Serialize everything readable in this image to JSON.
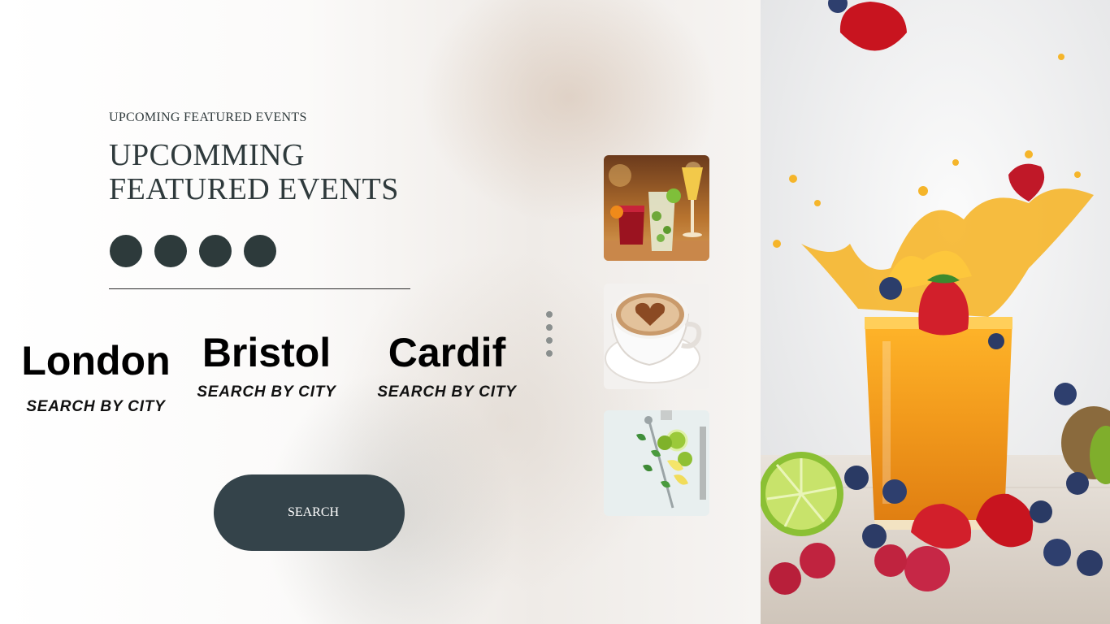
{
  "hero": {
    "eyebrow": "UPCOMING FEATURED EVENTS",
    "title": "UPCOMMING FEATURED EVENTS"
  },
  "cities": [
    {
      "name": "London",
      "subtitle": "SEARCH BY CITY"
    },
    {
      "name": "Bristol",
      "subtitle": "SEARCH BY CITY"
    },
    {
      "name": "Cardif",
      "subtitle": "SEARCH BY CITY"
    }
  ],
  "search_button": {
    "label": "SEARCH"
  },
  "thumbnails": [
    {
      "icon": "cocktails-photo"
    },
    {
      "icon": "latte-heart-photo"
    },
    {
      "icon": "lime-mint-photo"
    }
  ],
  "colors": {
    "dark_slate": "#2d3a3b",
    "button": "#34434a",
    "juice": "#f29a1c"
  }
}
